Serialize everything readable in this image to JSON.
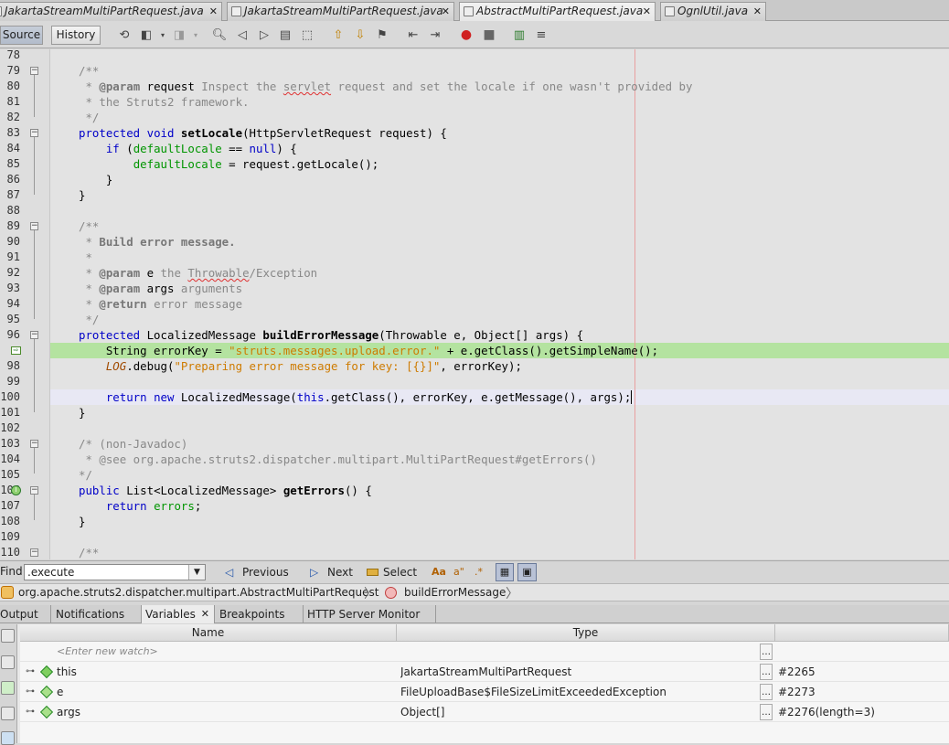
{
  "tabs": [
    {
      "label": "JakartaStreamMultiPartRequest.java",
      "active": false
    },
    {
      "label": "JakartaStreamMultiPartRequest.java",
      "active": false
    },
    {
      "label": "AbstractMultiPartRequest.java",
      "active": true
    },
    {
      "label": "OgnlUtil.java",
      "active": false
    }
  ],
  "toolbar": {
    "source_label": "Source",
    "history_label": "History"
  },
  "editor": {
    "line_numbers": [
      "78",
      "79",
      "80",
      "81",
      "82",
      "83",
      "84",
      "85",
      "86",
      "87",
      "88",
      "89",
      "90",
      "91",
      "92",
      "93",
      "94",
      "95",
      "96",
      "97",
      "98",
      "99",
      "100",
      "101",
      "102",
      "103",
      "104",
      "105",
      "106",
      "107",
      "108",
      "109",
      "110"
    ]
  },
  "findbar": {
    "find_label": "Find:",
    "find_value": ".execute",
    "previous_label": "Previous",
    "next_label": "Next",
    "select_label": "Select"
  },
  "breadcrumb": {
    "class_path": "org.apache.struts2.dispatcher.multipart.AbstractMultiPartRequest",
    "method": "buildErrorMessage"
  },
  "panel_tabs": [
    {
      "label": "Output",
      "active": false
    },
    {
      "label": "Notifications",
      "active": false
    },
    {
      "label": "Variables",
      "active": true
    },
    {
      "label": "Breakpoints",
      "active": false
    },
    {
      "label": "HTTP Server Monitor",
      "active": false
    }
  ],
  "variables": {
    "columns": [
      "Name",
      "Type"
    ],
    "new_watch_placeholder": "<Enter new watch>",
    "rows": [
      {
        "name": "this",
        "type": "JakartaStreamMultiPartRequest",
        "value": "#2265"
      },
      {
        "name": "e",
        "type": "FileUploadBase$FileSizeLimitExceededException",
        "value": "#2273"
      },
      {
        "name": "args",
        "type": "Object[]",
        "value": "#2276(length=3)"
      }
    ]
  }
}
